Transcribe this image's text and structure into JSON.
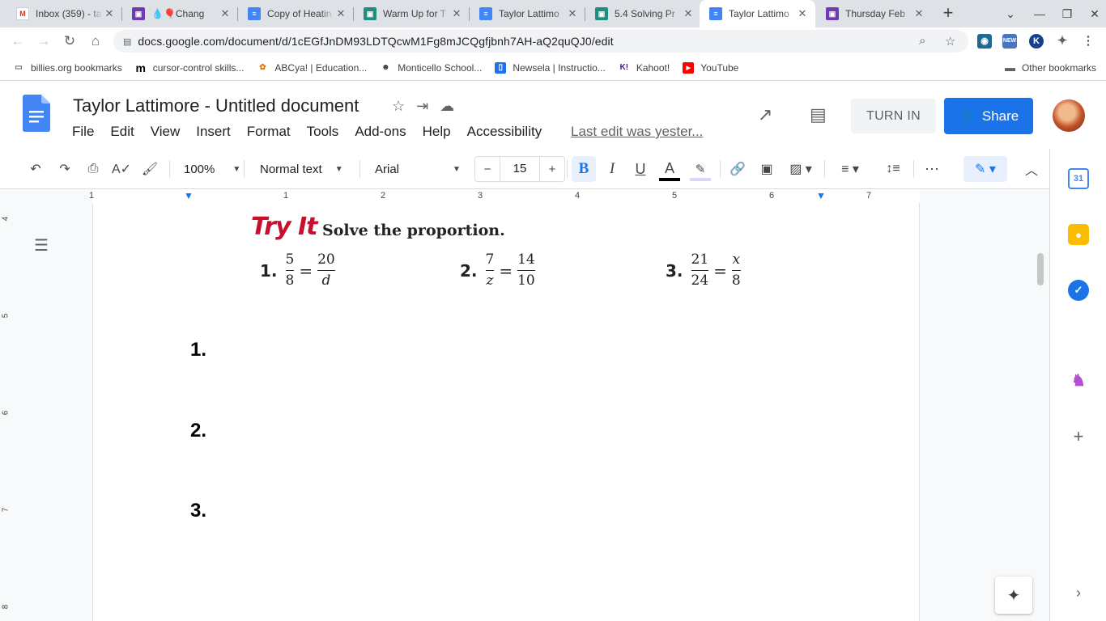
{
  "browser": {
    "tabs": [
      {
        "title": "Inbox (359) - ta",
        "icon": "gmail-icon"
      },
      {
        "title": "💧🎈Chang",
        "icon": "classroom-assignment-icon"
      },
      {
        "title": "Copy of Heatin",
        "icon": "docs-icon"
      },
      {
        "title": "Warm Up for T",
        "icon": "classroom-icon"
      },
      {
        "title": "Taylor Lattimo",
        "icon": "docs-icon"
      },
      {
        "title": "5.4 Solving Pr",
        "icon": "classroom-icon"
      },
      {
        "title": "Taylor Lattimo",
        "icon": "docs-icon",
        "active": true
      },
      {
        "title": "Thursday Feb",
        "icon": "classroom-assignment-icon"
      }
    ],
    "url": "docs.google.com/document/d/1cEGfJnDM93LDTQcwM1Fg8mJCQgfjbnh7AH-aQ2quQJ0/edit",
    "bookmarks": [
      "billies.org bookmarks",
      "cursor-control skills...",
      "ABCya! | Education...",
      "Monticello School...",
      "Newsela | Instructio...",
      "Kahoot!",
      "YouTube"
    ],
    "other_bookmarks": "Other bookmarks",
    "ext_badge": "NEW"
  },
  "docs": {
    "title": "Taylor Lattimore - Untitled document",
    "menu": [
      "File",
      "Edit",
      "View",
      "Insert",
      "Format",
      "Tools",
      "Add-ons",
      "Help",
      "Accessibility"
    ],
    "last_edit": "Last edit was yester...",
    "turn_in": "TURN IN",
    "share": "Share",
    "toolbar": {
      "zoom": "100%",
      "style": "Normal text",
      "font": "Arial",
      "font_size": "15"
    },
    "ruler_numbers": [
      "1",
      "1",
      "2",
      "3",
      "4",
      "5",
      "6",
      "7"
    ],
    "vruler_numbers": [
      "4",
      "5",
      "6",
      "7",
      "8"
    ],
    "calendar_day": "31"
  },
  "content": {
    "try_it": "Try It",
    "instruction": "Solve the proportion.",
    "problems": [
      {
        "num": "1.",
        "a_num": "5",
        "a_den": "8",
        "b_num": "20",
        "b_den": "d"
      },
      {
        "num": "2.",
        "a_num": "7",
        "a_den": "z",
        "b_num": "14",
        "b_den": "10"
      },
      {
        "num": "3.",
        "a_num": "21",
        "a_den": "24",
        "b_num": "x",
        "b_den": "8"
      }
    ],
    "equals": "=",
    "answers": [
      "1.",
      "2.",
      "3."
    ]
  },
  "colors": {
    "accent": "#1a73e8",
    "try_it_red": "#c8102e"
  }
}
